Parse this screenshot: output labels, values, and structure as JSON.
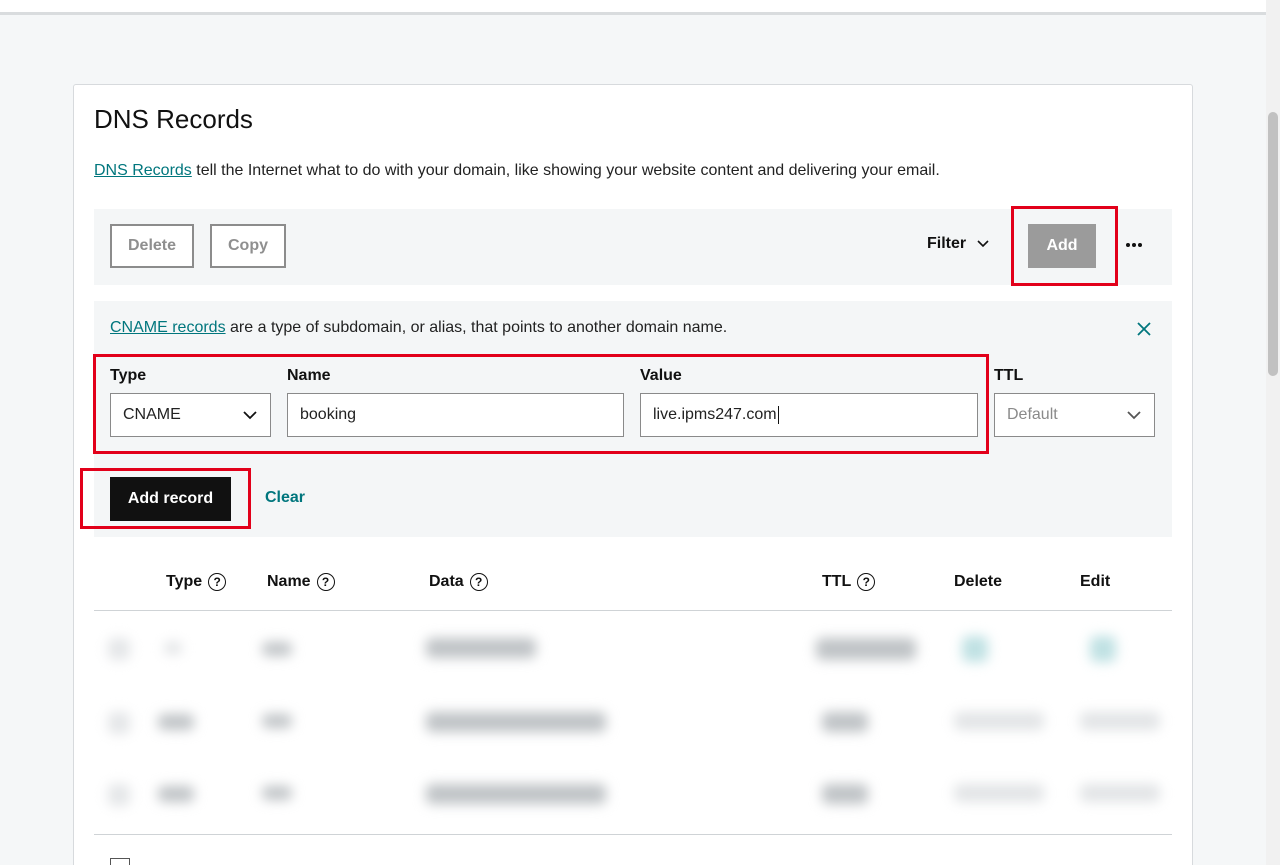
{
  "page": {
    "title": "DNS Records",
    "intro_link": "DNS Records",
    "intro_text": " tell the Internet what to do with your domain, like showing your website content and delivering your email."
  },
  "toolbar": {
    "delete_label": "Delete",
    "copy_label": "Copy",
    "filter_label": "Filter",
    "add_label": "Add",
    "more_icon": "ellipsis-icon"
  },
  "form": {
    "info_link": "CNAME records",
    "info_text": " are a type of subdomain, or alias, that points to another domain name.",
    "type_label": "Type",
    "type_value": "CNAME",
    "name_label": "Name",
    "name_value": "booking",
    "value_label": "Value",
    "value_value": "live.ipms247.com",
    "ttl_label": "TTL",
    "ttl_value": "Default",
    "add_record_label": "Add record",
    "clear_label": "Clear"
  },
  "table": {
    "columns": [
      "Type",
      "Name",
      "Data",
      "TTL",
      "Delete",
      "Edit"
    ]
  },
  "colors": {
    "accent": "#00767d",
    "highlight": "#e2001a",
    "primary_button": "#111111",
    "disabled_button": "#9b9b9b"
  }
}
